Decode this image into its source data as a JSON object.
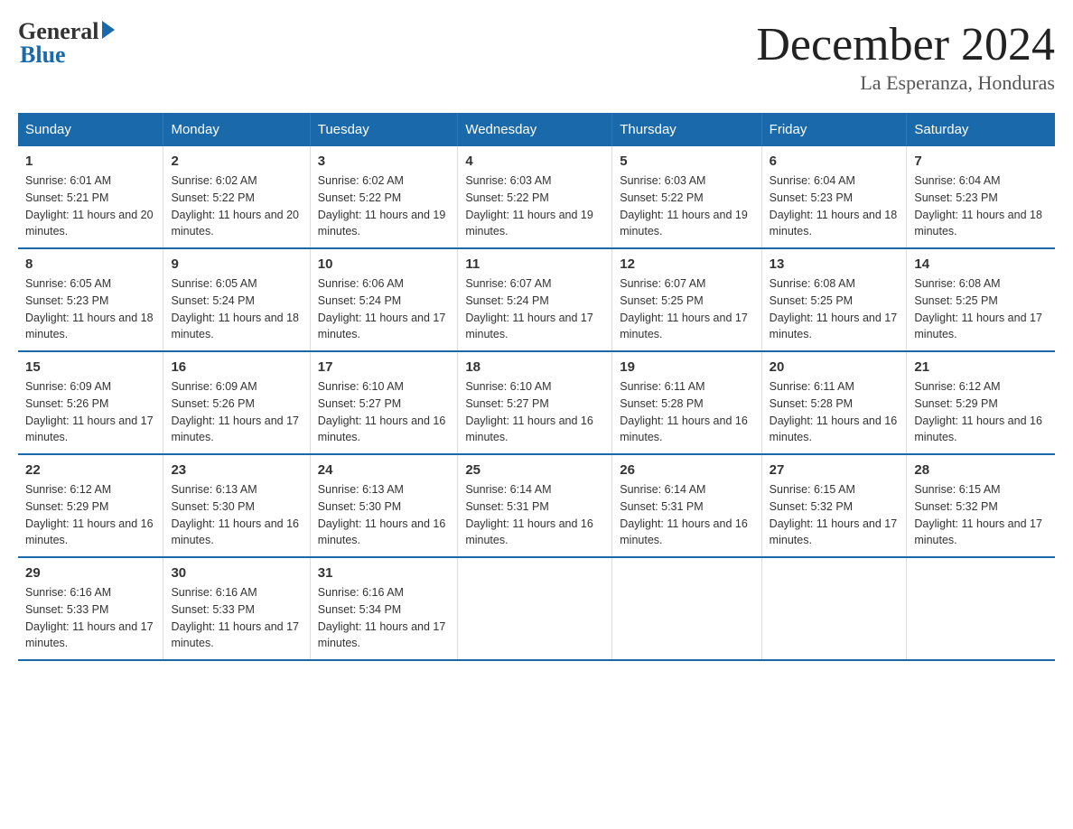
{
  "logo": {
    "general": "General",
    "blue": "Blue"
  },
  "title": "December 2024",
  "subtitle": "La Esperanza, Honduras",
  "days_of_week": [
    "Sunday",
    "Monday",
    "Tuesday",
    "Wednesday",
    "Thursday",
    "Friday",
    "Saturday"
  ],
  "weeks": [
    [
      {
        "num": "1",
        "sunrise": "6:01 AM",
        "sunset": "5:21 PM",
        "daylight": "11 hours and 20 minutes."
      },
      {
        "num": "2",
        "sunrise": "6:02 AM",
        "sunset": "5:22 PM",
        "daylight": "11 hours and 20 minutes."
      },
      {
        "num": "3",
        "sunrise": "6:02 AM",
        "sunset": "5:22 PM",
        "daylight": "11 hours and 19 minutes."
      },
      {
        "num": "4",
        "sunrise": "6:03 AM",
        "sunset": "5:22 PM",
        "daylight": "11 hours and 19 minutes."
      },
      {
        "num": "5",
        "sunrise": "6:03 AM",
        "sunset": "5:22 PM",
        "daylight": "11 hours and 19 minutes."
      },
      {
        "num": "6",
        "sunrise": "6:04 AM",
        "sunset": "5:23 PM",
        "daylight": "11 hours and 18 minutes."
      },
      {
        "num": "7",
        "sunrise": "6:04 AM",
        "sunset": "5:23 PM",
        "daylight": "11 hours and 18 minutes."
      }
    ],
    [
      {
        "num": "8",
        "sunrise": "6:05 AM",
        "sunset": "5:23 PM",
        "daylight": "11 hours and 18 minutes."
      },
      {
        "num": "9",
        "sunrise": "6:05 AM",
        "sunset": "5:24 PM",
        "daylight": "11 hours and 18 minutes."
      },
      {
        "num": "10",
        "sunrise": "6:06 AM",
        "sunset": "5:24 PM",
        "daylight": "11 hours and 17 minutes."
      },
      {
        "num": "11",
        "sunrise": "6:07 AM",
        "sunset": "5:24 PM",
        "daylight": "11 hours and 17 minutes."
      },
      {
        "num": "12",
        "sunrise": "6:07 AM",
        "sunset": "5:25 PM",
        "daylight": "11 hours and 17 minutes."
      },
      {
        "num": "13",
        "sunrise": "6:08 AM",
        "sunset": "5:25 PM",
        "daylight": "11 hours and 17 minutes."
      },
      {
        "num": "14",
        "sunrise": "6:08 AM",
        "sunset": "5:25 PM",
        "daylight": "11 hours and 17 minutes."
      }
    ],
    [
      {
        "num": "15",
        "sunrise": "6:09 AM",
        "sunset": "5:26 PM",
        "daylight": "11 hours and 17 minutes."
      },
      {
        "num": "16",
        "sunrise": "6:09 AM",
        "sunset": "5:26 PM",
        "daylight": "11 hours and 17 minutes."
      },
      {
        "num": "17",
        "sunrise": "6:10 AM",
        "sunset": "5:27 PM",
        "daylight": "11 hours and 16 minutes."
      },
      {
        "num": "18",
        "sunrise": "6:10 AM",
        "sunset": "5:27 PM",
        "daylight": "11 hours and 16 minutes."
      },
      {
        "num": "19",
        "sunrise": "6:11 AM",
        "sunset": "5:28 PM",
        "daylight": "11 hours and 16 minutes."
      },
      {
        "num": "20",
        "sunrise": "6:11 AM",
        "sunset": "5:28 PM",
        "daylight": "11 hours and 16 minutes."
      },
      {
        "num": "21",
        "sunrise": "6:12 AM",
        "sunset": "5:29 PM",
        "daylight": "11 hours and 16 minutes."
      }
    ],
    [
      {
        "num": "22",
        "sunrise": "6:12 AM",
        "sunset": "5:29 PM",
        "daylight": "11 hours and 16 minutes."
      },
      {
        "num": "23",
        "sunrise": "6:13 AM",
        "sunset": "5:30 PM",
        "daylight": "11 hours and 16 minutes."
      },
      {
        "num": "24",
        "sunrise": "6:13 AM",
        "sunset": "5:30 PM",
        "daylight": "11 hours and 16 minutes."
      },
      {
        "num": "25",
        "sunrise": "6:14 AM",
        "sunset": "5:31 PM",
        "daylight": "11 hours and 16 minutes."
      },
      {
        "num": "26",
        "sunrise": "6:14 AM",
        "sunset": "5:31 PM",
        "daylight": "11 hours and 16 minutes."
      },
      {
        "num": "27",
        "sunrise": "6:15 AM",
        "sunset": "5:32 PM",
        "daylight": "11 hours and 17 minutes."
      },
      {
        "num": "28",
        "sunrise": "6:15 AM",
        "sunset": "5:32 PM",
        "daylight": "11 hours and 17 minutes."
      }
    ],
    [
      {
        "num": "29",
        "sunrise": "6:16 AM",
        "sunset": "5:33 PM",
        "daylight": "11 hours and 17 minutes."
      },
      {
        "num": "30",
        "sunrise": "6:16 AM",
        "sunset": "5:33 PM",
        "daylight": "11 hours and 17 minutes."
      },
      {
        "num": "31",
        "sunrise": "6:16 AM",
        "sunset": "5:34 PM",
        "daylight": "11 hours and 17 minutes."
      },
      null,
      null,
      null,
      null
    ]
  ]
}
